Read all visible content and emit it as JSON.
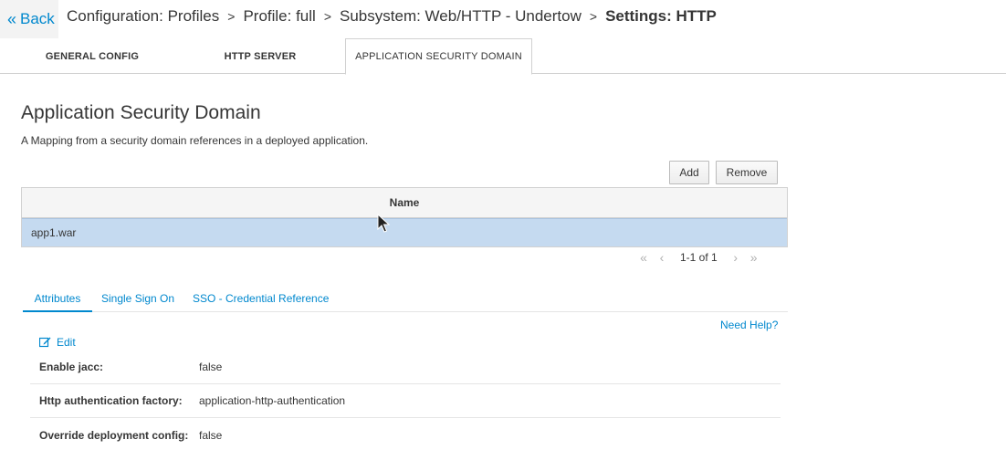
{
  "header": {
    "back_label": "Back",
    "breadcrumbs": [
      "Configuration: Profiles",
      "Profile: full",
      "Subsystem: Web/HTTP - Undertow"
    ],
    "current": "Settings: HTTP"
  },
  "tabs": [
    {
      "label": "GENERAL CONFIG",
      "active": false
    },
    {
      "label": "HTTP SERVER",
      "active": false
    },
    {
      "label": "APPLICATION SECURITY DOMAIN",
      "active": true
    }
  ],
  "main": {
    "title": "Application Security Domain",
    "description": "A Mapping from a security domain references in a deployed application.",
    "add_label": "Add",
    "remove_label": "Remove",
    "table": {
      "column": "Name",
      "rows": [
        "app1.war"
      ],
      "selected_row": 0
    },
    "pager": {
      "info": "1-1 of 1",
      "first_icon": "double-chevron-left-icon",
      "prev_icon": "chevron-left-icon",
      "next_icon": "chevron-right-icon",
      "last_icon": "double-chevron-right-icon"
    }
  },
  "details": {
    "subtabs": [
      {
        "label": "Attributes",
        "active": true
      },
      {
        "label": "Single Sign On",
        "active": false
      },
      {
        "label": "SSO - Credential Reference",
        "active": false
      }
    ],
    "need_help": "Need Help?",
    "edit_label": "Edit",
    "attributes": [
      {
        "label": "Enable jacc:",
        "value": "false"
      },
      {
        "label": "Http authentication factory:",
        "value": "application-http-authentication"
      },
      {
        "label": "Override deployment config:",
        "value": "false"
      }
    ]
  },
  "colors": {
    "link": "#0088ce",
    "selected_row": "#c5daf0",
    "text": "#363636"
  }
}
